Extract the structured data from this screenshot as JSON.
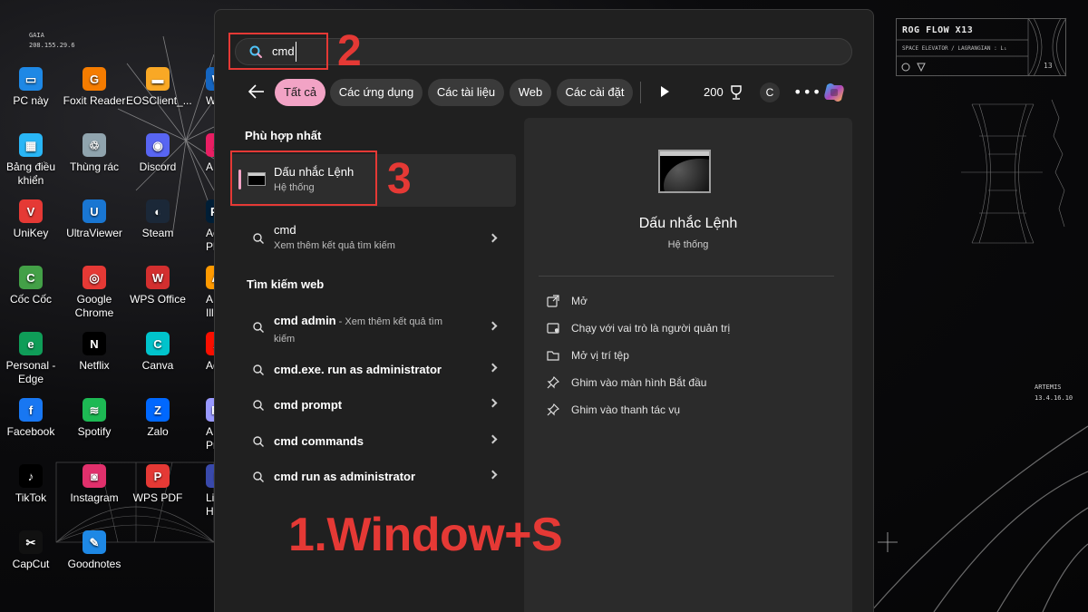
{
  "desktop": {
    "net_label": "GAIA",
    "ip": "208.155.29.6",
    "icons": [
      {
        "label": "PC này",
        "icon": "pc-icon",
        "color": "#1e88e5",
        "glyph": "▭"
      },
      {
        "label": "Foxit Reader",
        "icon": "foxit-icon",
        "color": "#f57c00",
        "glyph": "G"
      },
      {
        "label": "EOSClient_...",
        "icon": "folder-icon",
        "color": "#f9a825",
        "glyph": "▬"
      },
      {
        "label": "W",
        "icon": "w-icon",
        "color": "#1565c0",
        "glyph": "W"
      },
      {
        "label": "Bảng điều khiển",
        "icon": "control-panel-icon",
        "color": "#29b6f6",
        "glyph": "▦"
      },
      {
        "label": "Thùng rác",
        "icon": "recycle-bin-icon",
        "color": "#90a4ae",
        "glyph": "♲"
      },
      {
        "label": "Discord",
        "icon": "discord-icon",
        "color": "#5865f2",
        "glyph": "◉"
      },
      {
        "label": "A",
        "icon": "a-icon",
        "color": "#e91e63",
        "glyph": "A"
      },
      {
        "label": "UniKey",
        "icon": "unikey-icon",
        "color": "#e53935",
        "glyph": "V"
      },
      {
        "label": "UltraViewer",
        "icon": "ultraviewer-icon",
        "color": "#1976d2",
        "glyph": "U"
      },
      {
        "label": "Steam",
        "icon": "steam-icon",
        "color": "#1b2838",
        "glyph": "◐"
      },
      {
        "label": "Ac Pho",
        "icon": "photoshop-icon",
        "color": "#001e36",
        "glyph": "Ps"
      },
      {
        "label": "Cốc Cốc",
        "icon": "coccoc-icon",
        "color": "#43a047",
        "glyph": "C"
      },
      {
        "label": "Google Chrome",
        "icon": "chrome-icon",
        "color": "#e53935",
        "glyph": "◎"
      },
      {
        "label": "WPS Office",
        "icon": "wps-office-icon",
        "color": "#d32f2f",
        "glyph": "W"
      },
      {
        "label": "A Illu",
        "icon": "illustrator-icon",
        "color": "#ff9a00",
        "glyph": "Ai"
      },
      {
        "label": "Personal - Edge",
        "icon": "edge-icon",
        "color": "#0f9d58",
        "glyph": "e"
      },
      {
        "label": "Netflix",
        "icon": "netflix-icon",
        "color": "#000000",
        "glyph": "N"
      },
      {
        "label": "Canva",
        "icon": "canva-icon",
        "color": "#00c4cc",
        "glyph": "C"
      },
      {
        "label": "Adc",
        "icon": "adobe-icon",
        "color": "#fa0f00",
        "glyph": "A"
      },
      {
        "label": "Facebook",
        "icon": "facebook-icon",
        "color": "#1877f2",
        "glyph": "f"
      },
      {
        "label": "Spotify",
        "icon": "spotify-icon",
        "color": "#1db954",
        "glyph": "≋"
      },
      {
        "label": "Zalo",
        "icon": "zalo-icon",
        "color": "#0068ff",
        "glyph": "Z"
      },
      {
        "label": "A Prem",
        "icon": "premiere-icon",
        "color": "#9999ff",
        "glyph": "Pr"
      },
      {
        "label": "TikTok",
        "icon": "tiktok-icon",
        "color": "#000000",
        "glyph": "♪"
      },
      {
        "label": "Instagram",
        "icon": "instagram-icon",
        "color": "#e1306c",
        "glyph": "◙"
      },
      {
        "label": "WPS PDF",
        "icon": "wps-pdf-icon",
        "color": "#e53935",
        "glyph": "P"
      },
      {
        "label": "Liê Huyề",
        "icon": "lien-minh-icon",
        "color": "#3949ab",
        "glyph": "L"
      },
      {
        "label": "CapCut",
        "icon": "capcut-icon",
        "color": "#111111",
        "glyph": "✂"
      },
      {
        "label": "Goodnotes",
        "icon": "goodnotes-icon",
        "color": "#1e88e5",
        "glyph": "✎"
      }
    ]
  },
  "hud": {
    "title": "ROG FLOW X13",
    "subtitle": "SPACE ELEVATOR / LAGRANGIAN : L₁",
    "number": "13",
    "artemis_name": "ARTEMIS",
    "artemis_code": "13.4.16.10"
  },
  "search": {
    "query": "cmd",
    "filters": [
      {
        "label": "Tất cả",
        "active": true
      },
      {
        "label": "Các ứng dụng",
        "active": false
      },
      {
        "label": "Các tài liệu",
        "active": false
      },
      {
        "label": "Web",
        "active": false
      },
      {
        "label": "Các cài đặt",
        "active": false
      }
    ],
    "points": "200",
    "avatar_letter": "C",
    "more_label": "•••"
  },
  "results": {
    "best_match_title": "Phù hợp nhất",
    "best": {
      "title": "Dấu nhắc Lệnh",
      "subtitle": "Hệ thống"
    },
    "cmd_item": {
      "title": "cmd",
      "subtitle": "Xem thêm kết quả tìm kiếm"
    },
    "web_title": "Tìm kiếm web",
    "web_first": {
      "title": "cmd admin",
      "suffix": " - Xem thêm kết quả tìm",
      "suffix2": "kiếm"
    },
    "web_items": [
      "cmd.exe. run as administrator",
      "cmd prompt",
      "cmd commands",
      "cmd run as administrator"
    ]
  },
  "preview": {
    "title": "Dấu nhắc Lệnh",
    "subtitle": "Hệ thống",
    "actions": [
      {
        "label": "Mở",
        "icon": "open-external-icon"
      },
      {
        "label": "Chạy với vai trò là người quản trị",
        "icon": "shield-admin-icon"
      },
      {
        "label": "Mở vị trí tệp",
        "icon": "folder-icon"
      },
      {
        "label": "Ghim vào màn hình Bắt đầu",
        "icon": "pin-icon"
      },
      {
        "label": "Ghim vào thanh tác vụ",
        "icon": "pin-icon"
      }
    ]
  },
  "annotations": {
    "step2": "2",
    "step3": "3",
    "caption": "1.Window+S",
    "color": "#e53935"
  }
}
